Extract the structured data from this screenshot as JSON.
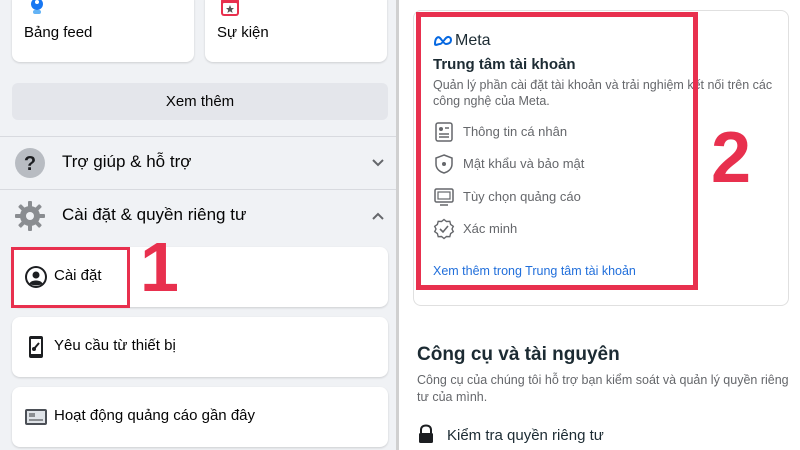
{
  "left_panel": {
    "shortcuts": [
      {
        "label": "Bảng feed",
        "icon": "feed-icon"
      },
      {
        "label": "Sự kiện",
        "icon": "calendar-icon"
      }
    ],
    "see_more": "Xem thêm",
    "sections": [
      {
        "label": "Trợ giúp & hỗ trợ",
        "icon": "help-icon",
        "expanded": false
      },
      {
        "label": "Cài đặt & quyền riêng tư",
        "icon": "gear-icon",
        "expanded": true
      }
    ],
    "items": [
      {
        "label": "Cài đặt",
        "icon": "profile-icon"
      },
      {
        "label": "Yêu cầu từ thiết bị",
        "icon": "phone-icon"
      },
      {
        "label": "Hoạt động quảng cáo gần đây",
        "icon": "ad-icon"
      }
    ],
    "step_number": "1"
  },
  "right_panel": {
    "accounts_center": {
      "brand": "Meta",
      "title": "Trung tâm tài khoản",
      "description": "Quản lý phần cài đặt tài khoản và trải nghiệm kết nối trên các công nghệ của Meta.",
      "rows": [
        {
          "label": "Thông tin cá nhân",
          "icon": "id-card-icon"
        },
        {
          "label": "Mật khẩu và bảo mật",
          "icon": "shield-icon"
        },
        {
          "label": "Tùy chọn quảng cáo",
          "icon": "monitor-icon"
        },
        {
          "label": "Xác minh",
          "icon": "verified-icon"
        }
      ],
      "link": "Xem thêm trong Trung tâm tài khoản"
    },
    "step_number": "2",
    "tools": {
      "title": "Công cụ và tài nguyên",
      "description": "Công cụ của chúng tôi hỗ trợ bạn kiểm soát và quản lý quyền riêng tư của mình.",
      "first_item": "Kiểm tra quyền riêng tư"
    }
  },
  "colors": {
    "highlight": "#e8304e",
    "link": "#216fdb",
    "facebook_blue": "#1877f2"
  }
}
